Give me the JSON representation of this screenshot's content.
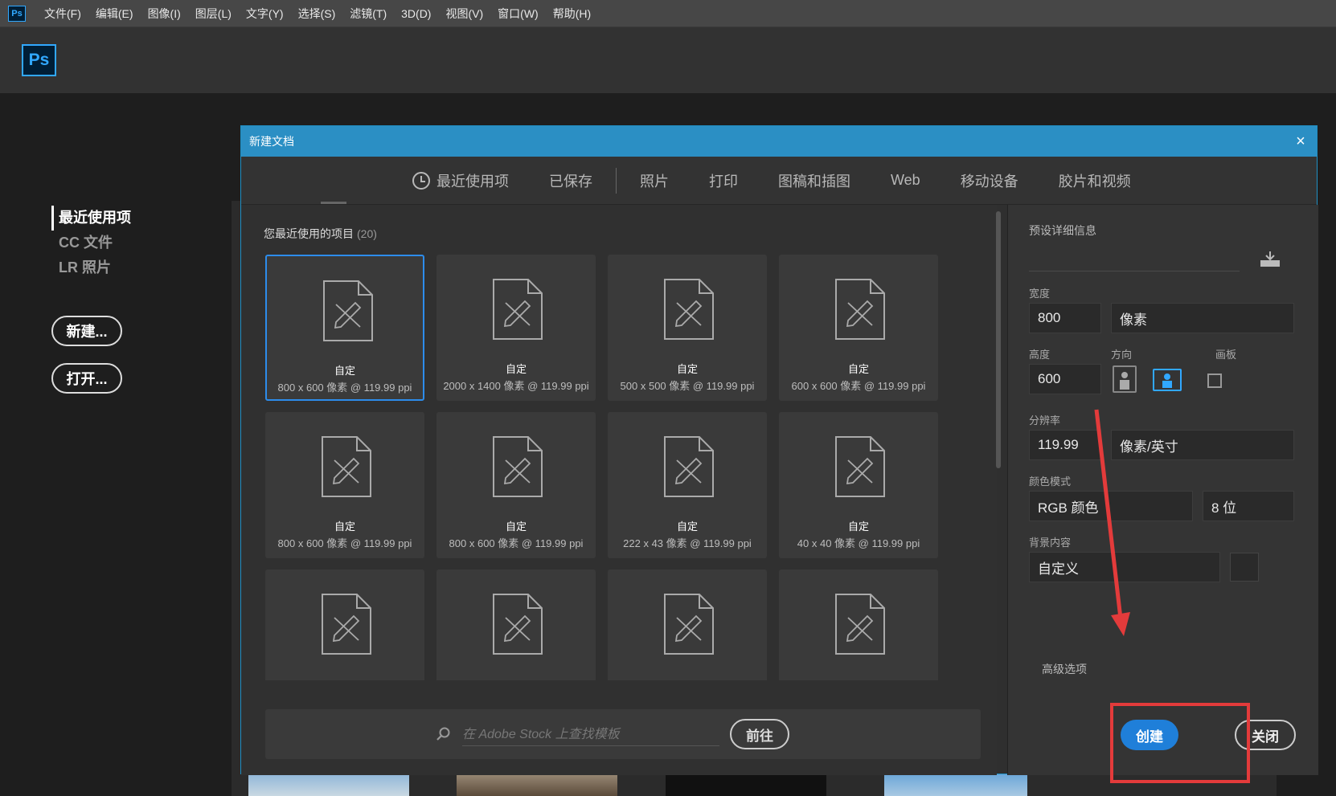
{
  "menubar": {
    "app_icon": "Ps",
    "items": [
      "文件(F)",
      "编辑(E)",
      "图像(I)",
      "图层(L)",
      "文字(Y)",
      "选择(S)",
      "滤镜(T)",
      "3D(D)",
      "视图(V)",
      "窗口(W)",
      "帮助(H)"
    ]
  },
  "header": {
    "logo": "Ps"
  },
  "start": {
    "nav": [
      "最近使用项",
      "CC 文件",
      "LR 照片"
    ],
    "new_button": "新建...",
    "open_button": "打开..."
  },
  "dialog": {
    "title": "新建文档",
    "close": "×",
    "tabs": [
      "最近使用项",
      "已保存",
      "照片",
      "打印",
      "图稿和插图",
      "Web",
      "移动设备",
      "胶片和视频"
    ],
    "section_title": "您最近使用的项目",
    "section_count": "(20)",
    "cards": [
      {
        "name": "自定",
        "size": "800 x 600 像素 @ 119.99 ppi"
      },
      {
        "name": "自定",
        "size": "2000 x 1400 像素 @ 119.99 ppi"
      },
      {
        "name": "自定",
        "size": "500 x 500 像素 @ 119.99 ppi"
      },
      {
        "name": "自定",
        "size": "600 x 600 像素 @ 119.99 ppi"
      },
      {
        "name": "自定",
        "size": "800 x 600 像素 @ 119.99 ppi"
      },
      {
        "name": "自定",
        "size": "800 x 600 像素 @ 119.99 ppi"
      },
      {
        "name": "自定",
        "size": "222 x 43 像素 @ 119.99 ppi"
      },
      {
        "name": "自定",
        "size": "40 x 40 像素 @ 119.99 ppi"
      },
      {
        "name": "",
        "size": ""
      },
      {
        "name": "",
        "size": ""
      },
      {
        "name": "",
        "size": ""
      },
      {
        "name": "",
        "size": ""
      }
    ],
    "search_placeholder": "在 Adobe Stock 上查找模板",
    "goto_button": "前往",
    "preset": {
      "title": "预设详细信息",
      "width_label": "宽度",
      "width_value": "800",
      "width_unit": "像素",
      "height_label": "高度",
      "height_value": "600",
      "orientation_label": "方向",
      "artboard_label": "画板",
      "resolution_label": "分辨率",
      "resolution_value": "119.99",
      "resolution_unit": "像素/英寸",
      "color_mode_label": "颜色模式",
      "color_mode_value": "RGB 颜色",
      "bit_depth": "8 位",
      "background_label": "背景内容",
      "background_value": "自定义",
      "advanced": "高级选项"
    },
    "create_button": "创建",
    "close_button": "关闭"
  },
  "colors": {
    "accent": "#31a8ff",
    "titlebar": "#2b8fc4",
    "annotation": "#e33b3b"
  }
}
